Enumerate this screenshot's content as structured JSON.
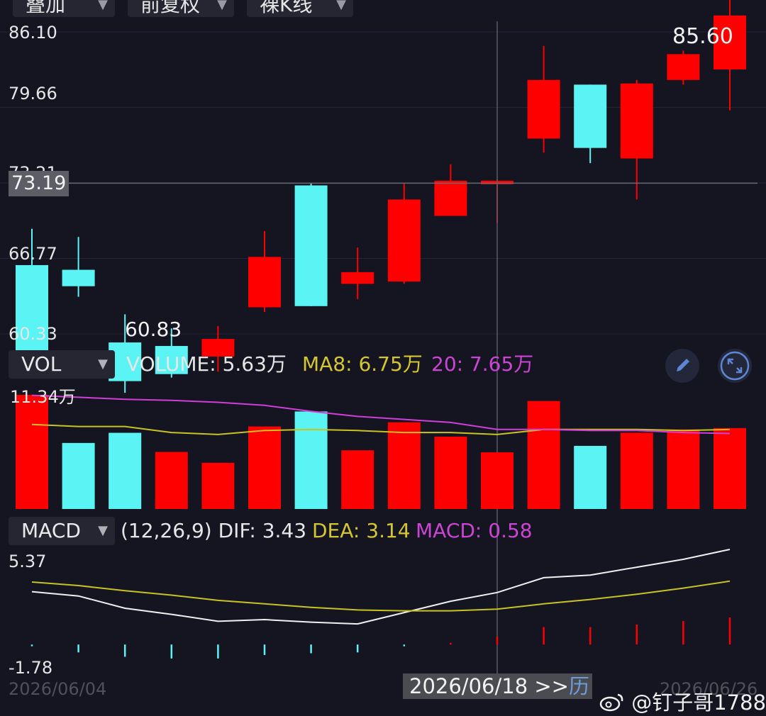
{
  "top_dropdowns": [
    {
      "label": "叠加"
    },
    {
      "label": "前复权"
    },
    {
      "label": "裸K线"
    }
  ],
  "price_axis": {
    "labels": [
      "86.10",
      "79.66",
      "73.21",
      "66.77",
      "60.33"
    ],
    "crosshair_price": "73.19",
    "high_label": "85.60",
    "low_label": "60.83"
  },
  "volume_panel": {
    "selector": "VOL",
    "volume_text": "VOLUME: 5.63万",
    "ma8_text": "MA8: 6.75万",
    "ma20_text": "20: 7.65万",
    "max_label": "11.34万"
  },
  "macd_panel": {
    "selector": "MACD",
    "params_text": "(12,26,9) DIF: 3.43",
    "dea_text": "DEA: 3.14",
    "macd_text": "MACD: 0.58",
    "max_label": "5.37",
    "min_label": "-1.78"
  },
  "footer": {
    "start_date": "2026/06/04",
    "cursor_date": "2026/06/18 >>",
    "history_label": "历",
    "end_date": "2026/06/26",
    "watermark": "@钉子哥1788"
  },
  "icons": [
    "chevron-down-icon",
    "pencil-icon",
    "expand-icon",
    "weibo-icon"
  ],
  "colors": {
    "background": "#151522",
    "up": "#ff0000",
    "down": "#5bf4f4",
    "dif_line": "#f0f0f0",
    "dea_line": "#c9c221",
    "ma20_line": "#d03ed8",
    "ma8_text": "#d4c62e",
    "ma20_text": "#cc44d4"
  },
  "chart_data": [
    {
      "type": "candlestick",
      "title": "",
      "ylim": [
        60.33,
        86.1
      ],
      "candles": [
        {
          "open": 66.2,
          "close": 58.8,
          "high": 69.3,
          "low": 58.3
        },
        {
          "open": 65.8,
          "close": 64.4,
          "high": 68.6,
          "low": 63.5
        },
        {
          "open": 59.6,
          "close": 56.3,
          "high": 62.0,
          "low": 55.3
        },
        {
          "open": 59.3,
          "close": 56.9,
          "high": 60.8,
          "low": 56.6
        },
        {
          "open": 58.4,
          "close": 59.9,
          "high": 61.0,
          "low": 57.1
        },
        {
          "open": 62.6,
          "close": 66.9,
          "high": 69.1,
          "low": 62.2
        },
        {
          "open": 73.0,
          "close": 62.7,
          "high": 73.2,
          "low": 62.7
        },
        {
          "open": 64.6,
          "close": 65.6,
          "high": 67.7,
          "low": 63.3
        },
        {
          "open": 64.8,
          "close": 71.8,
          "high": 73.2,
          "low": 64.6
        },
        {
          "open": 70.4,
          "close": 73.4,
          "high": 74.8,
          "low": 70.4
        },
        {
          "open": 73.1,
          "close": 73.4,
          "high": 73.5,
          "low": 69.8
        },
        {
          "open": 77.0,
          "close": 82.0,
          "high": 84.9,
          "low": 75.8
        },
        {
          "open": 81.6,
          "close": 76.2,
          "high": 81.6,
          "low": 74.9
        },
        {
          "open": 75.3,
          "close": 81.7,
          "high": 82.0,
          "low": 71.8
        },
        {
          "open": 82.0,
          "close": 84.2,
          "high": 84.5,
          "low": 81.6
        },
        {
          "open": 82.9,
          "close": 87.5,
          "high": 90.5,
          "low": 79.4
        }
      ]
    },
    {
      "type": "bar",
      "ylim": [
        0,
        11.34
      ],
      "series": [
        {
          "name": "VOLUME",
          "values": [
            11.34,
            6.56,
            7.57,
            5.67,
            4.59,
            8.2,
            9.69,
            5.83,
            8.62,
            7.19,
            5.63,
            10.73,
            6.27,
            7.58,
            7.9,
            8.04
          ]
        },
        {
          "name": "MA8",
          "values": [
            8.4,
            8.2,
            8.2,
            7.6,
            7.4,
            7.8,
            7.9,
            7.8,
            7.6,
            7.6,
            7.4,
            7.9,
            7.9,
            7.9,
            7.8,
            7.9
          ]
        },
        {
          "name": "20",
          "values": [
            11.3,
            11.1,
            10.9,
            10.8,
            10.6,
            10.3,
            9.7,
            9.2,
            8.9,
            8.6,
            7.9,
            7.9,
            7.8,
            7.8,
            7.6,
            7.5
          ]
        }
      ],
      "up_down": [
        "up",
        "down",
        "down",
        "up",
        "up",
        "up",
        "down",
        "up",
        "up",
        "up",
        "up",
        "up",
        "down",
        "up",
        "up",
        "up"
      ]
    },
    {
      "type": "line",
      "ylim": [
        -1.78,
        5.37
      ],
      "series": [
        {
          "name": "DIF",
          "values": [
            2.95,
            2.7,
            2.0,
            1.65,
            1.25,
            1.35,
            1.2,
            1.1,
            1.75,
            2.4,
            2.9,
            3.75,
            3.9,
            4.35,
            4.8,
            5.37
          ]
        },
        {
          "name": "DEA",
          "values": [
            3.5,
            3.3,
            3.0,
            2.75,
            2.45,
            2.25,
            2.05,
            1.9,
            1.85,
            1.85,
            1.95,
            2.25,
            2.5,
            2.8,
            3.15,
            3.55
          ]
        },
        {
          "name": "MACD",
          "values": [
            -0.1,
            -0.45,
            -0.7,
            -0.8,
            -0.8,
            -0.6,
            -0.5,
            -0.45,
            -0.1,
            0.1,
            0.45,
            1.0,
            1.0,
            1.15,
            1.35,
            1.55
          ]
        }
      ]
    }
  ]
}
